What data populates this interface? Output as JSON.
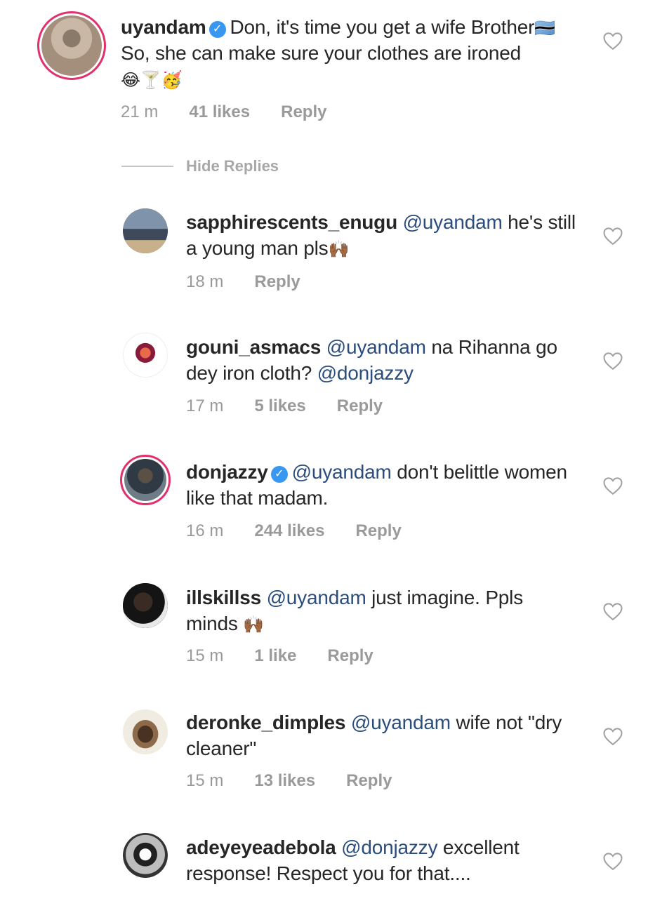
{
  "main_comment": {
    "username": "uyandam",
    "verified": true,
    "text_1": "Don, it's time you get a wife Brother",
    "text_2": " So, she can make sure your clothes are ironed ",
    "emoji_flag": "🇧🇼",
    "emoji_tail": "😂🍸🥳",
    "time": "21 m",
    "likes": "41 likes",
    "reply": "Reply"
  },
  "hide_replies_label": "Hide Replies",
  "replies": [
    {
      "username": "sapphirescents_enugu",
      "verified": false,
      "mention": "@uyandam",
      "text": " he's still a young man pls",
      "emoji": "🙌🏾",
      "time": "18 m",
      "likes": "",
      "reply": "Reply"
    },
    {
      "username": "gouni_asmacs",
      "verified": false,
      "mention": "@uyandam",
      "text": " na Rihanna go dey iron cloth? ",
      "mention2": "@donjazzy",
      "time": "17 m",
      "likes": "5 likes",
      "reply": "Reply"
    },
    {
      "username": "donjazzy",
      "verified": true,
      "mention": "@uyandam",
      "text": " don't belittle women like that madam.",
      "time": "16 m",
      "likes": "244 likes",
      "reply": "Reply"
    },
    {
      "username": "illskillss",
      "verified": false,
      "mention": "@uyandam",
      "text": " just imagine. Ppls minds ",
      "emoji": "🙌🏾",
      "time": "15 m",
      "likes": "1 like",
      "reply": "Reply"
    },
    {
      "username": "deronke_dimples",
      "verified": false,
      "mention": "@uyandam",
      "text": " wife not \"dry cleaner\"",
      "time": "15 m",
      "likes": "13 likes",
      "reply": "Reply"
    },
    {
      "username": "adeyeyeadebola",
      "verified": false,
      "mention": "@donjazzy",
      "text": " excellent response! Respect you for that....",
      "time": "",
      "likes": "",
      "reply": ""
    }
  ],
  "icons": {
    "like": "heart-outline-icon",
    "verified": "verified-badge-icon"
  },
  "colors": {
    "mention": "#2b4d7e",
    "meta": "#9a9a9a",
    "verified": "#3897f0",
    "story_ring": "#e1306c"
  }
}
